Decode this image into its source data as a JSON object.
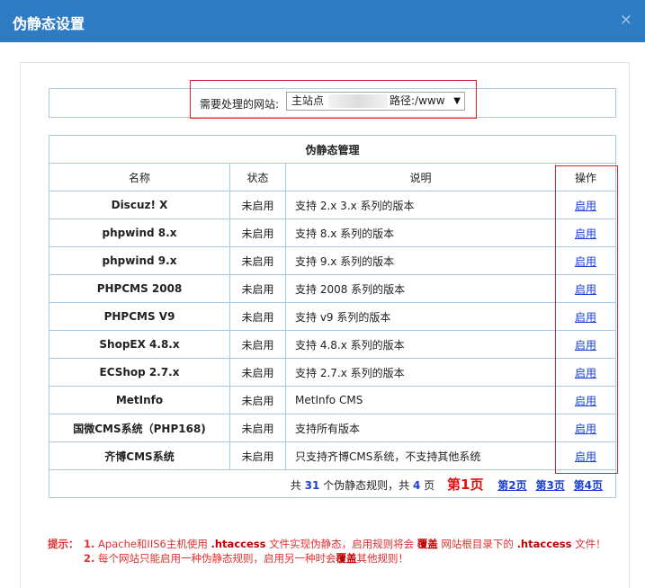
{
  "dialog": {
    "title": "伪静态设置",
    "close_symbol": "×"
  },
  "site_select": {
    "label": "需要处理的网站:",
    "site_prefix": "主站点",
    "path_label": "路径:/www",
    "arrow": "▼"
  },
  "table": {
    "caption": "伪静态管理",
    "headers": {
      "name": "名称",
      "status": "状态",
      "desc": "说明",
      "action": "操作"
    },
    "rows": [
      {
        "name": "Discuz! X",
        "status": "未启用",
        "desc": "支持 2.x 3.x 系列的版本",
        "action": "启用"
      },
      {
        "name": "phpwind 8.x",
        "status": "未启用",
        "desc": "支持 8.x 系列的版本",
        "action": "启用"
      },
      {
        "name": "phpwind 9.x",
        "status": "未启用",
        "desc": "支持 9.x 系列的版本",
        "action": "启用"
      },
      {
        "name": "PHPCMS 2008",
        "status": "未启用",
        "desc": "支持 2008 系列的版本",
        "action": "启用"
      },
      {
        "name": "PHPCMS V9",
        "status": "未启用",
        "desc": "支持 v9 系列的版本",
        "action": "启用"
      },
      {
        "name": "ShopEX 4.8.x",
        "status": "未启用",
        "desc": "支持 4.8.x 系列的版本",
        "action": "启用"
      },
      {
        "name": "ECShop 2.7.x",
        "status": "未启用",
        "desc": "支持 2.7.x 系列的版本",
        "action": "启用"
      },
      {
        "name": "MetInfo",
        "status": "未启用",
        "desc": "MetInfo CMS",
        "action": "启用"
      },
      {
        "name": "国微CMS系统（PHP168)",
        "status": "未启用",
        "desc": "支持所有版本",
        "action": "启用"
      },
      {
        "name": "齐博CMS系统",
        "status": "未启用",
        "desc": "只支持齐博CMS系统，不支持其他系统",
        "action": "启用"
      }
    ]
  },
  "pager": {
    "total_prefix": "共",
    "total_count": "31",
    "total_mid": "个伪静态规则，共",
    "page_count": "4",
    "page_suffix": "页",
    "current": "第1页",
    "pages": [
      "第2页",
      "第3页",
      "第4页"
    ]
  },
  "tips": {
    "label": "提示：",
    "line1": {
      "num": "1.",
      "a": "Apache和IIS6主机使用",
      "k1": ".htaccess",
      "b": "文件实现伪静态，启用规则将会",
      "k2": "覆盖",
      "c": "网站根目录下的",
      "k3": ".htaccess",
      "d": "文件！"
    },
    "line2": {
      "num": "2.",
      "a": "每个网站只能启用一种伪静态规则，启用另一种时会",
      "k1": "覆盖",
      "b": "其他规则！"
    }
  }
}
